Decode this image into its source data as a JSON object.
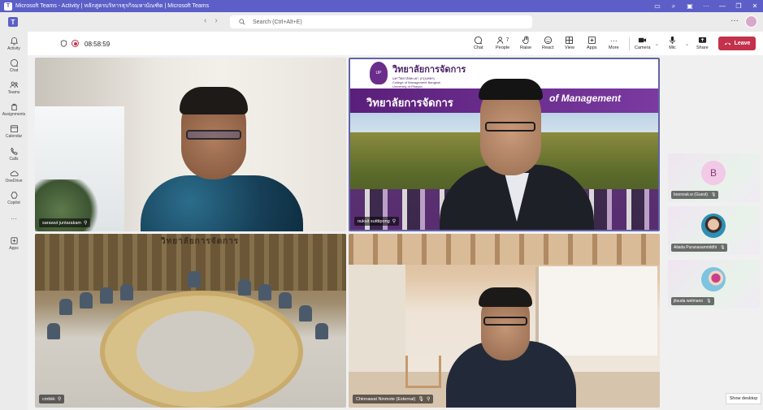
{
  "window": {
    "title": "Microsoft Teams - Activity | หลักสูตรบริหารธุรกิจมหาบัณฑิต | Microsoft Teams",
    "controls": [
      "video-icon",
      "pin-icon",
      "picture-icon",
      "more-icon",
      "minimize-icon",
      "restore-icon",
      "close-icon"
    ]
  },
  "header": {
    "search_placeholder": "Search (Ctrl+Alt+E)",
    "more": "···"
  },
  "rail": {
    "items": [
      {
        "label": "Activity",
        "icon": "bell-icon"
      },
      {
        "label": "Chat",
        "icon": "chat-icon"
      },
      {
        "label": "Teams",
        "icon": "teams-icon"
      },
      {
        "label": "Assignments",
        "icon": "assignments-icon"
      },
      {
        "label": "Calendar",
        "icon": "calendar-icon"
      },
      {
        "label": "Calls",
        "icon": "phone-icon"
      },
      {
        "label": "OneDrive",
        "icon": "cloud-icon"
      },
      {
        "label": "Copilot",
        "icon": "copilot-icon"
      },
      {
        "label": "···",
        "icon": "more-icon"
      },
      {
        "label": "Apps",
        "icon": "apps-icon"
      }
    ]
  },
  "meeting": {
    "timer": "08:58:59",
    "toolbar": {
      "chat": "Chat",
      "people": "People",
      "people_count": "7",
      "raise": "Raise",
      "react": "React",
      "view": "View",
      "apps": "Apps",
      "more": "More",
      "camera": "Camera",
      "mic": "Mic",
      "share": "Share",
      "leave": "Leave"
    },
    "accent": "#5b5fc7",
    "leave_color": "#c4314b"
  },
  "tiles": {
    "t1": {
      "name": "sarawut juntarakam"
    },
    "t2": {
      "name": "nuksit sutttipong",
      "banner_thai": "วิทยาลัยการจัดการ",
      "banner_sub1": "มหาวิทยาลัยพะเยา (กรุงเทพฯ)",
      "banner_sub2": "College of Management Bangkok",
      "banner_sub3": "University of Phayao",
      "band_thai": "วิทยาลัยการจัดการ",
      "band_en": "of Management"
    },
    "t3": {
      "name": "cmbkk",
      "sign": "วิทยาลัยการจัดการ"
    },
    "t4": {
      "name": "Chinnawat Ninmote (External)"
    }
  },
  "side_participants": [
    {
      "name": "boonsuk.w (Guest)",
      "initial": "B"
    },
    {
      "name": "Ailada Puranasamriddhi"
    },
    {
      "name": "jitsuda wetmano"
    }
  ],
  "show_desktop": "Show desktop"
}
